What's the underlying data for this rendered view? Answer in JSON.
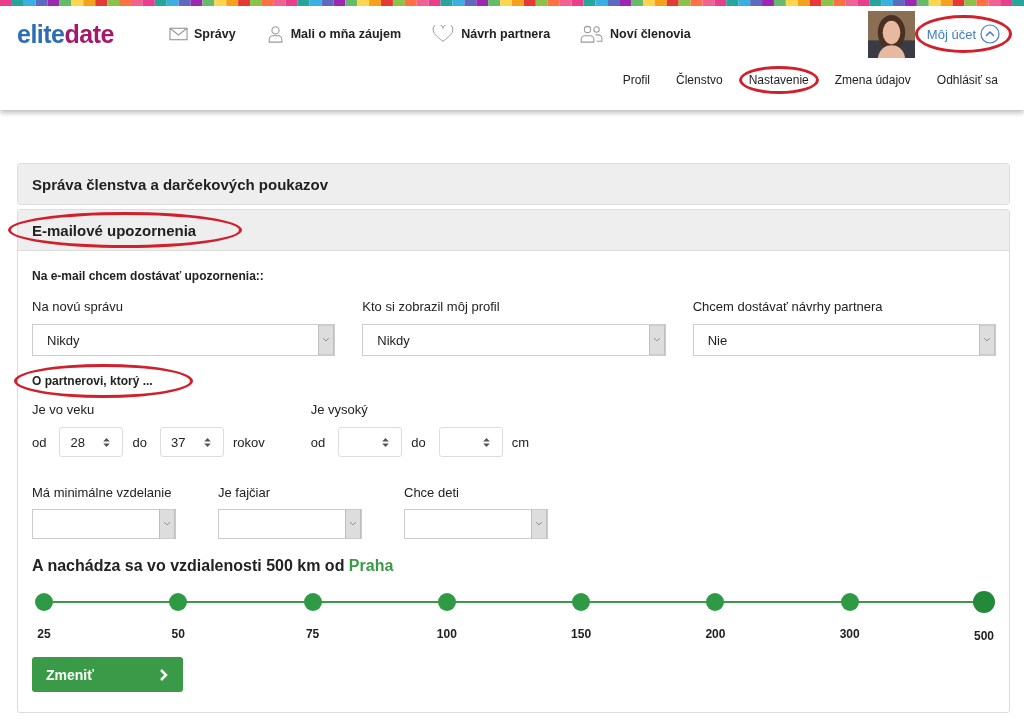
{
  "header": {
    "logo": {
      "part_1": "elite",
      "part_2": "date"
    },
    "nav": [
      {
        "label": "Správy"
      },
      {
        "label": "Mali o mňa záujem"
      },
      {
        "label": "Návrh partnera"
      },
      {
        "label": "Noví členovia"
      }
    ],
    "account": {
      "label": "Môj účet",
      "expanded": true,
      "circled": true
    },
    "subnav": [
      {
        "label": "Profil",
        "circled": false
      },
      {
        "label": "Členstvo",
        "circled": false
      },
      {
        "label": "Nastavenie",
        "circled": true
      },
      {
        "label": "Zmena údajov",
        "circled": false
      },
      {
        "label": "Odhlásiť sa",
        "circled": false
      }
    ]
  },
  "sections": [
    {
      "title": "Správa členstva a darčekových poukazov",
      "expanded": false,
      "circled": false
    },
    {
      "title": "E-mailové upozornenia",
      "expanded": true,
      "circled": true
    }
  ],
  "notifications": {
    "heading": "Na e-mail chcem dostávať upozornenia::",
    "selects": [
      {
        "label": "Na novú správu",
        "value": "Nikdy"
      },
      {
        "label": "Kto si zobrazil môj profil",
        "value": "Nikdy"
      },
      {
        "label": "Chcem dostávať návrhy partnera",
        "value": "Nie"
      }
    ]
  },
  "partner": {
    "heading": "O partnerovi, ktorý ...",
    "heading_circled": true,
    "ranges": [
      {
        "label": "Je vo veku",
        "from_label": "od",
        "from": "28",
        "to_label": "do",
        "to": "37",
        "unit": "rokov"
      },
      {
        "label": "Je vysoký",
        "from_label": "od",
        "to_label": "do",
        "unit": "cm"
      }
    ],
    "selects": [
      {
        "label": "Má minimálne vzdelanie"
      },
      {
        "label": "Je fajčiar"
      },
      {
        "label": "Chce deti"
      }
    ],
    "distance": {
      "text": "A nachádza sa vo vzdialenosti 500 km od",
      "city": "Praha",
      "level": 1,
      "stops": [
        {
          "label": "25",
          "selected": false
        },
        {
          "label": "50",
          "selected": false
        },
        {
          "label": "75",
          "selected": false
        },
        {
          "label": "100",
          "selected": false
        },
        {
          "label": "150",
          "selected": false
        },
        {
          "label": "200",
          "selected": false
        },
        {
          "label": "300",
          "selected": false
        },
        {
          "label": "500",
          "selected": true
        }
      ]
    },
    "button": "Zmeniť"
  }
}
